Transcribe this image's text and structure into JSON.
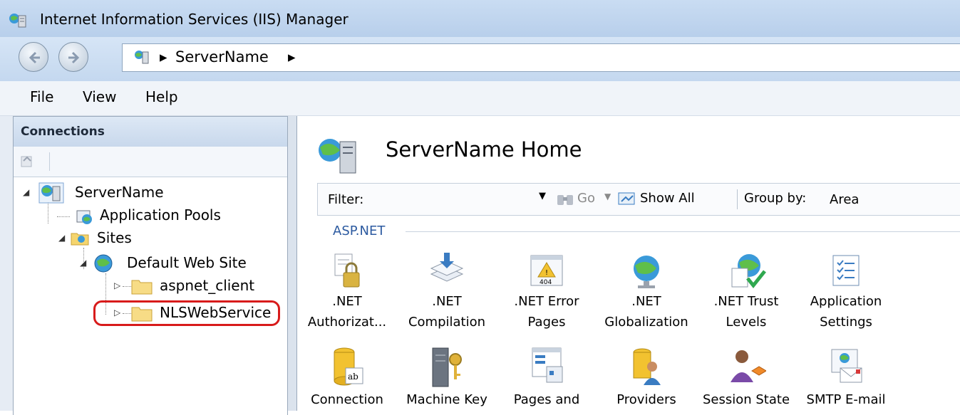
{
  "window": {
    "title": "Internet Information Services (IIS) Manager"
  },
  "address": {
    "crumbs": [
      "ServerName"
    ]
  },
  "menu": {
    "items": [
      "File",
      "View",
      "Help"
    ]
  },
  "connections": {
    "header": "Connections",
    "tree": {
      "server": "ServerName",
      "app_pools": "Application Pools",
      "sites": "Sites",
      "default_site": "Default Web Site",
      "aspnet_client": "aspnet_client",
      "nls": "NLSWebService"
    }
  },
  "main": {
    "title": "ServerName Home",
    "filter": {
      "label": "Filter:",
      "go": "Go",
      "show_all": "Show All",
      "group_by_label": "Group by:",
      "group_by_value": "Area"
    },
    "section": "ASP.NET",
    "features_row1": [
      {
        "line1": ".NET",
        "line2": "Authorizat...",
        "icon": "authorization-icon"
      },
      {
        "line1": ".NET",
        "line2": "Compilation",
        "icon": "compilation-icon"
      },
      {
        "line1": ".NET Error",
        "line2": "Pages",
        "icon": "error-pages-icon"
      },
      {
        "line1": ".NET",
        "line2": "Globalization",
        "icon": "globalization-icon"
      },
      {
        "line1": ".NET Trust",
        "line2": "Levels",
        "icon": "trust-levels-icon"
      },
      {
        "line1": "Application",
        "line2": "Settings",
        "icon": "app-settings-icon"
      }
    ],
    "features_row2": [
      {
        "line1": "Connection",
        "icon": "connection-strings-icon"
      },
      {
        "line1": "Machine Key",
        "icon": "machine-key-icon"
      },
      {
        "line1": "Pages and",
        "icon": "pages-controls-icon"
      },
      {
        "line1": "Providers",
        "icon": "providers-icon"
      },
      {
        "line1": "Session State",
        "icon": "session-state-icon"
      },
      {
        "line1": "SMTP E-mail",
        "icon": "smtp-email-icon"
      }
    ]
  },
  "colors": {
    "accent": "#2c5aa0",
    "highlight": "#d81b1b"
  }
}
